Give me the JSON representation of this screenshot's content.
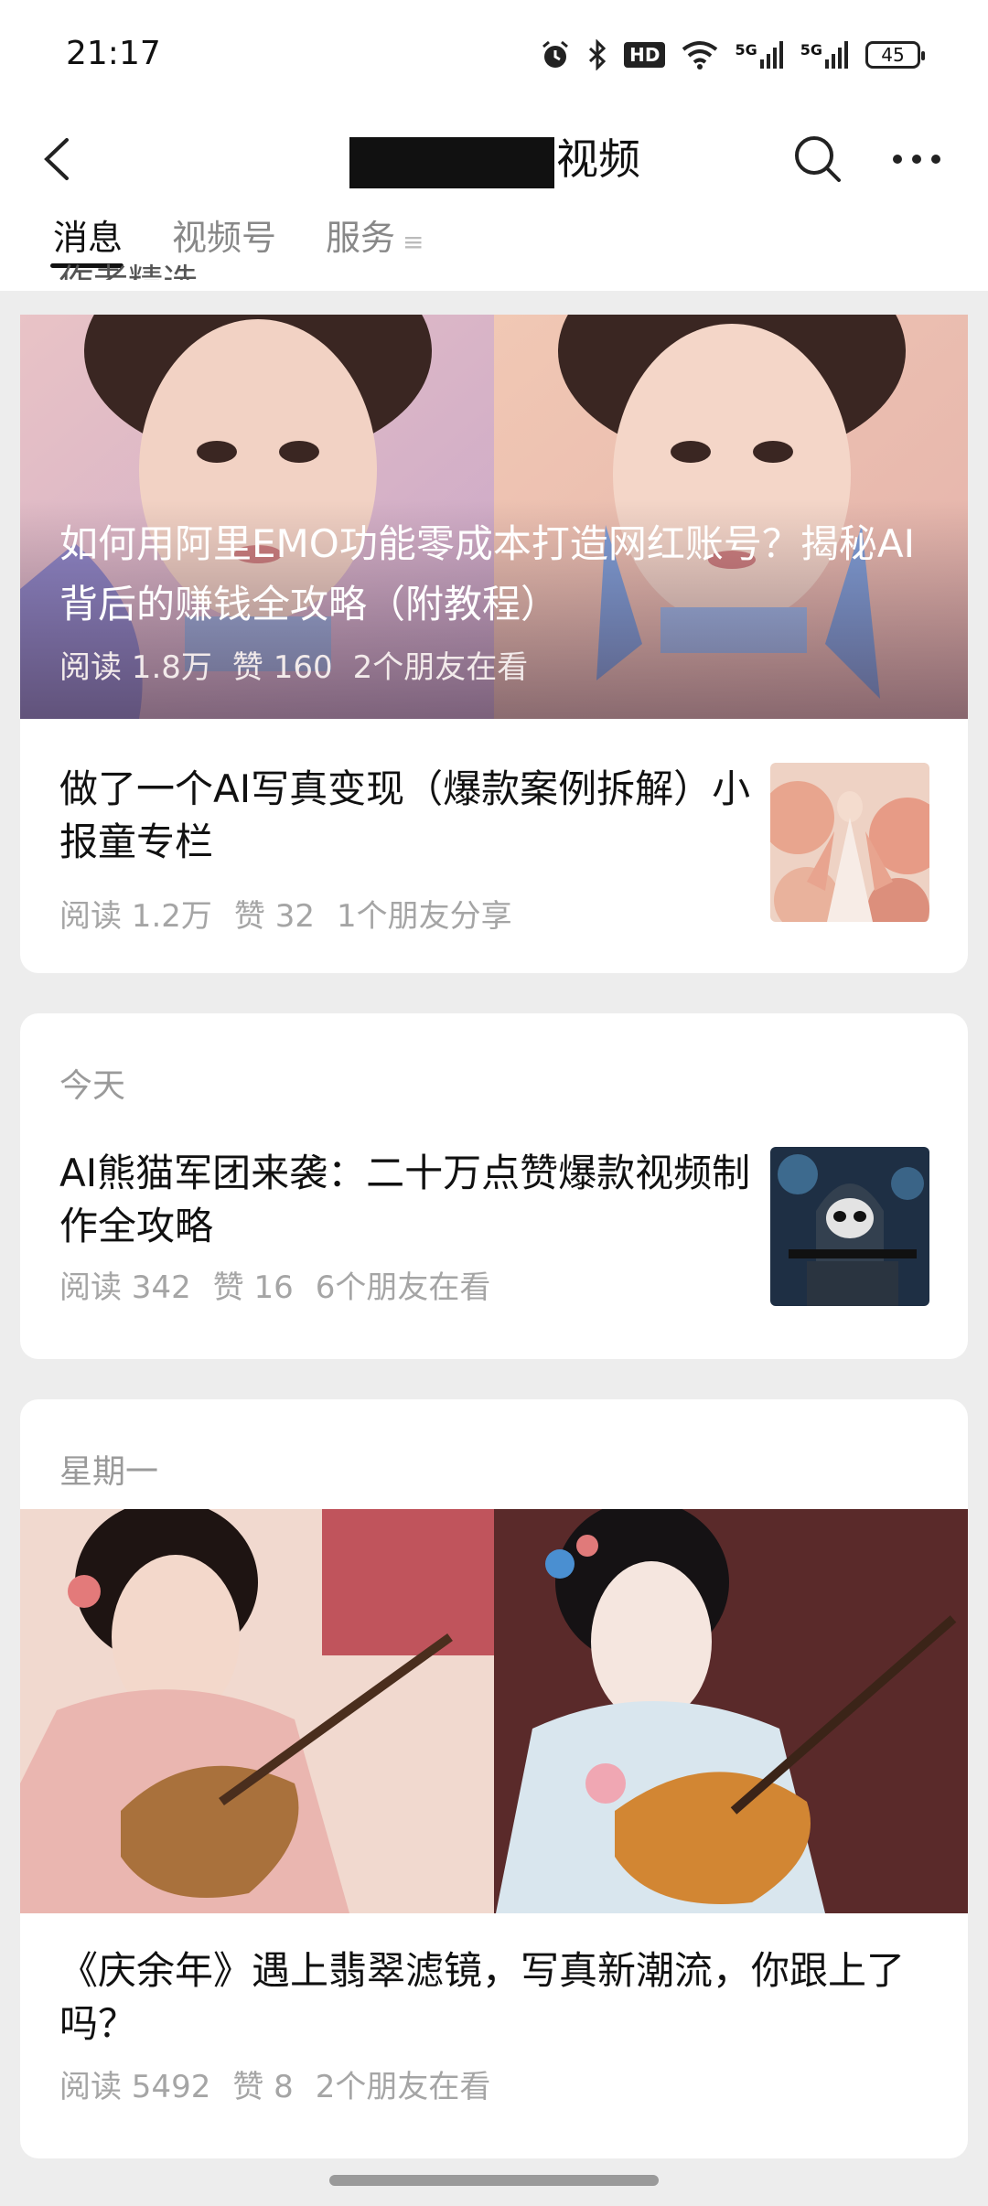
{
  "status_bar": {
    "time": "21:17",
    "hd_label": "HD",
    "net1_label": "5G",
    "net2_label": "5G",
    "battery": "45"
  },
  "header": {
    "title": "视频"
  },
  "tabs": [
    {
      "label": "消息",
      "active": true
    },
    {
      "label": "视频号",
      "active": false
    },
    {
      "label": "服务",
      "active": false
    }
  ],
  "clipped_section_title": "作者精选",
  "feed": {
    "hero_article": {
      "title": "如何用阿里EMO功能零成本打造网红账号？揭秘AI背后的赚钱全攻略（附教程）",
      "reads": "阅读 1.8万",
      "likes": "赞 160",
      "friends": "2个朋友在看"
    },
    "article_2": {
      "title": "做了一个AI写真变现（爆款案例拆解）小报童专栏",
      "reads": "阅读 1.2万",
      "likes": "赞 32",
      "friends": "1个朋友分享"
    },
    "group_today": {
      "date": "今天",
      "title": "AI熊猫军团来袭：二十万点赞爆款视频制作全攻略",
      "reads": "阅读 342",
      "likes": "赞 16",
      "friends": "6个朋友在看"
    },
    "group_monday": {
      "date": "星期一",
      "title": "《庆余年》遇上翡翠滤镜，写真新潮流，你跟上了吗？",
      "reads": "阅读 5492",
      "likes": "赞 8",
      "friends": "2个朋友在看"
    }
  }
}
